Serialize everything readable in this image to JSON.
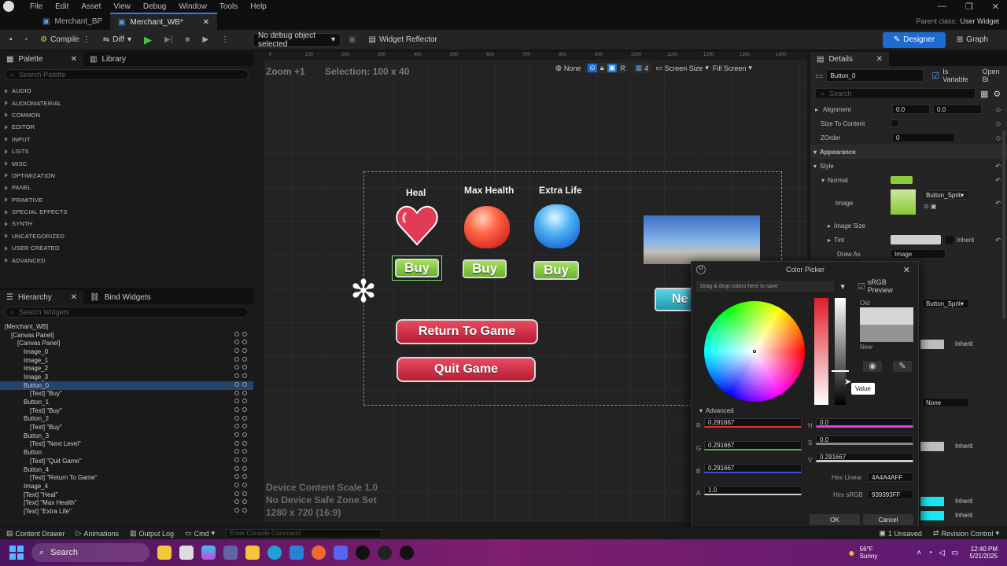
{
  "menu": [
    "File",
    "Edit",
    "Asset",
    "View",
    "Debug",
    "Window",
    "Tools",
    "Help"
  ],
  "tabs": [
    {
      "label": "Merchant_BP"
    },
    {
      "label": "Merchant_WB*"
    }
  ],
  "parent_class": {
    "label": "Parent class:",
    "value": "User Widget"
  },
  "toolbar": {
    "compile": "Compile",
    "diff": "Diff",
    "debug_select": "No debug object selected",
    "reflector": "Widget Reflector",
    "designer": "Designer",
    "graph": "Graph"
  },
  "palette": {
    "title": "Palette",
    "library": "Library",
    "search": "Search Palette",
    "categories": [
      "AUDIO",
      "AUDIOMATERIAL",
      "COMMON",
      "EDITOR",
      "INPUT",
      "LISTS",
      "MISC",
      "OPTIMIZATION",
      "PANEL",
      "PRIMITIVE",
      "SPECIAL EFFECTS",
      "SYNTH",
      "UNCATEGORIZED",
      "USER CREATED",
      "ADVANCED"
    ]
  },
  "hierarchy": {
    "title": "Hierarchy",
    "bind": "Bind Widgets",
    "search": "Search Widgets",
    "items": [
      "[Merchant_WB]",
      "[Canvas Panel]",
      "[Canvas Panel]",
      "Image_0",
      "Image_1",
      "Image_2",
      "Image_3",
      "Button_0",
      "[Text] \"Buy\"",
      "Button_1",
      "[Text] \"Buy\"",
      "Button_2",
      "[Text] \"Buy\"",
      "Button_3",
      "[Text] \"Next Level\"",
      "Button",
      "[Text] \"Quit Game\"",
      "Button_4",
      "[Text] \"Return To Game\"",
      "Image_4",
      "[Text] \"Heal\"",
      "[Text] \"Max Health\"",
      "[Text] \"Extra Life\""
    ]
  },
  "viewport": {
    "zoom": "Zoom +1",
    "selection": "Selection: 100 x 40",
    "none": "None",
    "r": "R",
    "four": "4",
    "screen_size": "Screen Size",
    "fill": "Fill Screen",
    "ruler": [
      "0",
      "100",
      "200",
      "300",
      "400",
      "500",
      "600",
      "700",
      "800",
      "900",
      "1000",
      "1100",
      "1200",
      "1300",
      "1400"
    ],
    "scale": "Device Content Scale 1.0",
    "safe": "No Device Safe Zone Set",
    "res": "1280 x 720 (16:9)"
  },
  "shop": {
    "heal": "Heal",
    "max_health": "Max Health",
    "extra_life": "Extra Life",
    "buy": "Buy",
    "return": "Return To Game",
    "quit": "Quit Game",
    "next": "Ne"
  },
  "details": {
    "title": "Details",
    "name": "Button_0",
    "is_variable": "Is Variable",
    "open_bind": "Open Bi",
    "search": "Search",
    "alignment": "Alignment",
    "align_x": "0.0",
    "align_y": "0.0",
    "size_to_content": "Size To Content",
    "zorder": "ZOrder",
    "zorder_val": "0",
    "appearance": "Appearance",
    "style": "Style",
    "normal": "Normal",
    "image": "Image",
    "image_val": "Button_Sprit",
    "image_size": "Image Size",
    "tint": "Tint",
    "inherit": "Inherit",
    "draw_as": "Draw As",
    "draw_val": "Image",
    "none": "None"
  },
  "picker": {
    "title": "Color Picker",
    "drag": "Drag & drop colors here to save",
    "srgb": "sRGB Preview",
    "old": "Old",
    "new": "New",
    "value_tip": "Value",
    "advanced": "Advanced",
    "r": "0.291667",
    "g": "0.291667",
    "b": "0.291667",
    "a": "1.0",
    "h": "0.0",
    "s": "0.0",
    "v": "0.291667",
    "hex_linear_label": "Hex Linear",
    "hex_linear": "4A4A4AFF",
    "hex_srgb_label": "Hex sRGB",
    "hex_srgb": "939393FF",
    "ok": "OK",
    "cancel": "Cancel"
  },
  "status": {
    "drawer": "Content Drawer",
    "animations": "Animations",
    "output": "Output Log",
    "cmd": "Cmd",
    "console": "Enter Console Command",
    "unsaved": "1 Unsaved",
    "revision": "Revision Control"
  },
  "taskbar": {
    "search": "Search",
    "temp": "56°F",
    "weather": "Sunny",
    "time": "12:40 PM",
    "date": "5/21/2025"
  }
}
